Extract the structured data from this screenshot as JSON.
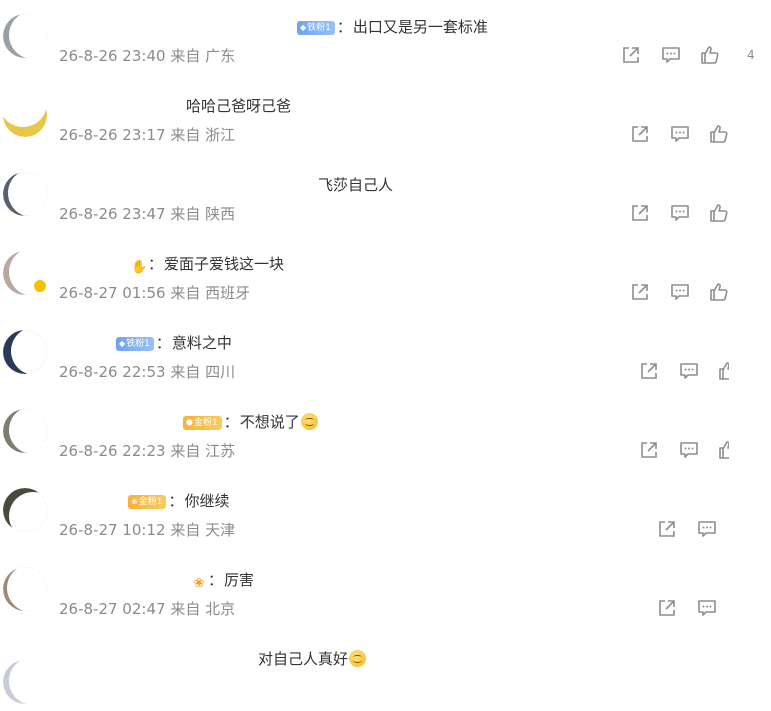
{
  "comments": [
    {
      "badge": "铁粉1",
      "icon": "",
      "text": "出口又是另一套标准",
      "smiley": false,
      "date": "26-8-26 23:40",
      "from": "来自",
      "location": "广东",
      "likes": "4"
    },
    {
      "badge": "",
      "icon": "",
      "text": "哈哈己爸呀己爸",
      "smiley": false,
      "date": "26-8-26 23:17",
      "from": "来自",
      "location": "浙江",
      "likes": ""
    },
    {
      "badge": "",
      "icon": "",
      "text": "飞莎自己人",
      "smiley": false,
      "date": "26-8-26 23:47",
      "from": "来自",
      "location": "陕西",
      "likes": ""
    },
    {
      "badge": "",
      "icon": "fan-icon",
      "text": "爱面子爱钱这一块",
      "smiley": false,
      "date": "26-8-27 01:56",
      "from": "来自",
      "location": "西班牙",
      "likes": ""
    },
    {
      "badge": "铁粉1",
      "icon": "",
      "text": "意料之中",
      "smiley": false,
      "date": "26-8-26 22:53",
      "from": "来自",
      "location": "四川",
      "likes": ""
    },
    {
      "badge": "金粉1",
      "icon": "",
      "text": "不想说了",
      "smiley": true,
      "date": "26-8-26 22:23",
      "from": "来自",
      "location": "江苏",
      "likes": ""
    },
    {
      "badge": "金粉1",
      "icon": "",
      "text": "你继续",
      "smiley": false,
      "date": "26-8-27 10:12",
      "from": "来自",
      "location": "天津",
      "likes": ""
    },
    {
      "badge": "",
      "icon": "flower-icon",
      "text": "厉害",
      "smiley": false,
      "date": "26-8-27 02:47",
      "from": "来自",
      "location": "北京",
      "likes": ""
    },
    {
      "badge": "",
      "icon": "",
      "text": "对自己人真好",
      "smiley": true,
      "date": "",
      "from": "",
      "location": "",
      "likes": ""
    }
  ],
  "colors": {
    "text": "#333333",
    "meta": "#8b8b8b",
    "icon": "#8e8e8e",
    "iron_badge": "#6ea4ee",
    "gold_badge": "#f7b23a"
  }
}
